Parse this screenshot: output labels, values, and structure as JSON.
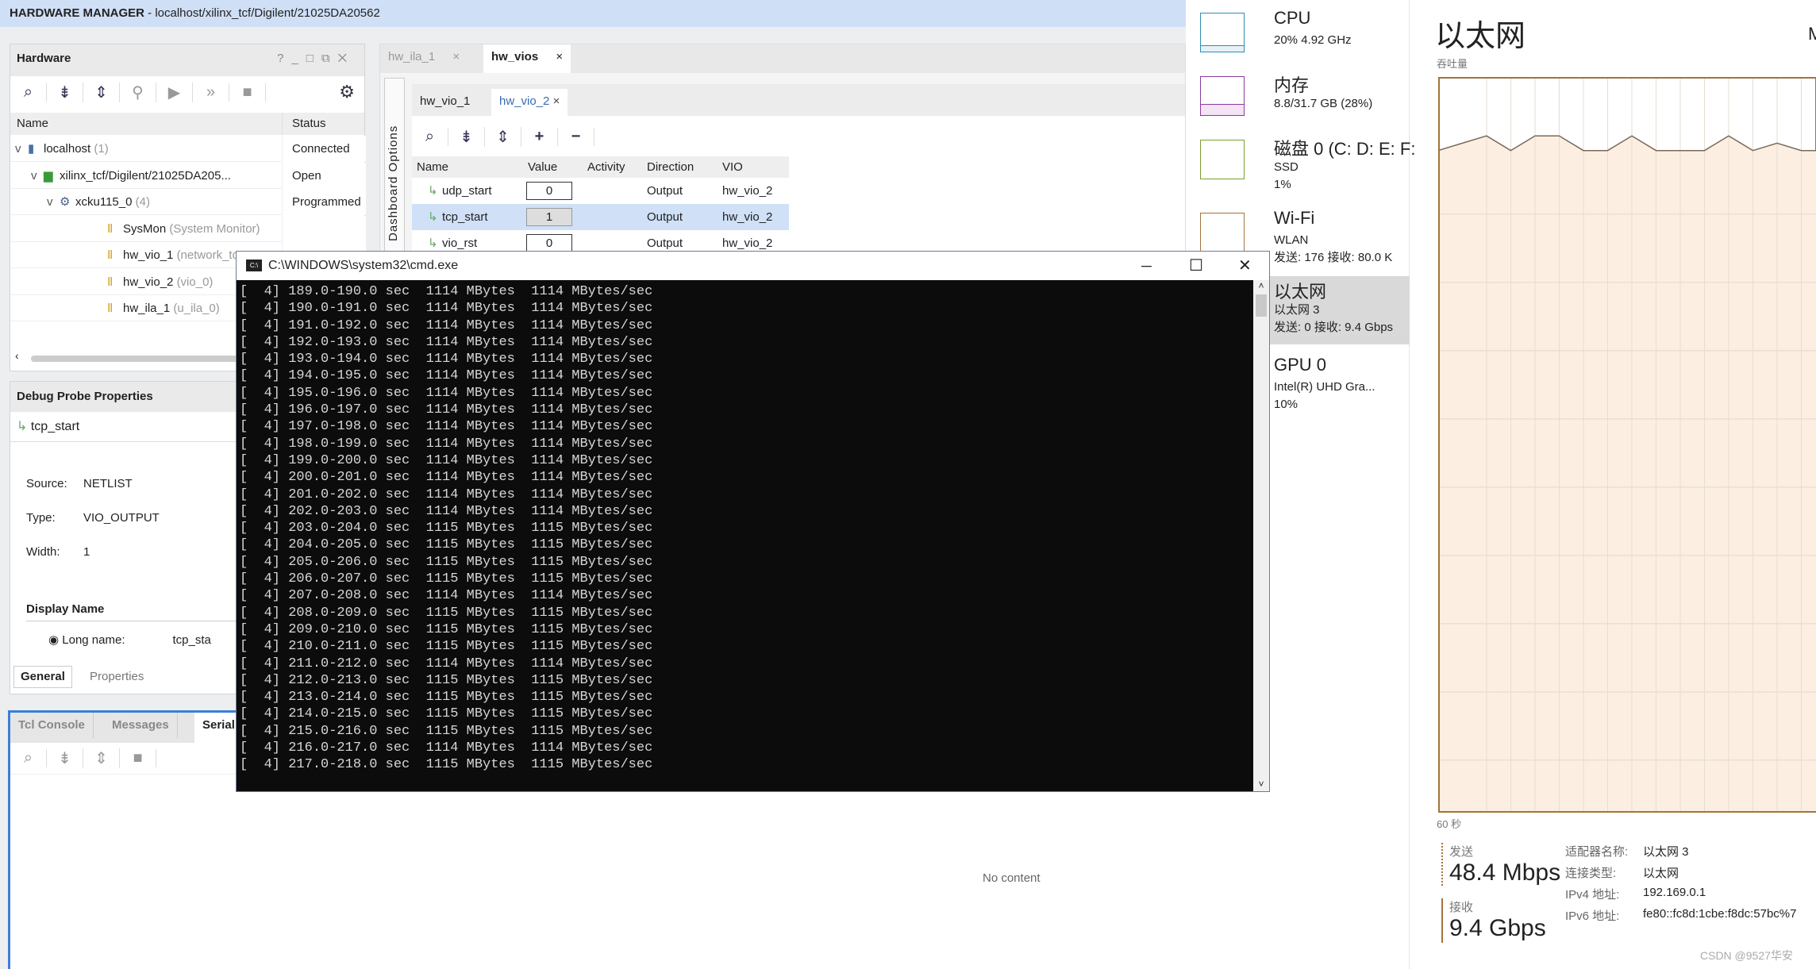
{
  "vivado": {
    "title_bold": "HARDWARE MANAGER",
    "title_rest": " - localhost/xilinx_tcf/Digilent/21025DA20562",
    "hardware": {
      "title": "Hardware",
      "ctrl_icons": [
        "?",
        "_",
        "□",
        "⧉",
        "X"
      ],
      "columns": [
        "Name",
        "Status"
      ],
      "rows": [
        {
          "name": "localhost",
          "extra": "(1)",
          "status": "Connected",
          "indent": 0,
          "icon": "server-icon",
          "chev": "v"
        },
        {
          "name": "xilinx_tcf/Digilent/21025DA205...",
          "extra": "",
          "status": "Open",
          "indent": 1,
          "icon": "board-icon",
          "chev": "v"
        },
        {
          "name": "xcku115_0",
          "extra": "(4)",
          "status": "Programmed",
          "indent": 2,
          "icon": "chip-icon",
          "chev": "v"
        },
        {
          "name": "SysMon",
          "extra": "(System Monitor)",
          "status": "",
          "indent": 3,
          "icon": "core-icon",
          "chev": ""
        },
        {
          "name": "hw_vio_1",
          "extra": "(network_top",
          "status": "",
          "indent": 3,
          "icon": "core-icon",
          "chev": ""
        },
        {
          "name": "hw_vio_2",
          "extra": "(vio_0)",
          "status": "",
          "indent": 3,
          "icon": "core-icon",
          "chev": ""
        },
        {
          "name": "hw_ila_1",
          "extra": "(u_ila_0)",
          "status": "",
          "indent": 3,
          "icon": "core-icon",
          "chev": ""
        }
      ]
    },
    "probe": {
      "title": "Debug Probe Properties",
      "name": "tcp_start",
      "props": [
        {
          "label": "Source:",
          "value": "NETLIST"
        },
        {
          "label": "Type:",
          "value": "VIO_OUTPUT"
        },
        {
          "label": "Width:",
          "value": "1"
        }
      ],
      "display_name": "Display Name",
      "long_name_label": "Long name:",
      "long_name_value": "tcp_sta",
      "tabs": [
        "General",
        "Properties"
      ]
    },
    "console": {
      "tabs": [
        "Tcl Console",
        "Messages",
        "Serial I"
      ]
    },
    "main_tabs": [
      "hw_ila_1",
      "hw_vios"
    ],
    "dashboard_label": "Dashboard Options",
    "vio_tabs": [
      "hw_vio_1",
      "hw_vio_2"
    ],
    "vio_columns": [
      "Name",
      "Value",
      "Activity",
      "Direction",
      "VIO"
    ],
    "vio_rows": [
      {
        "name": "udp_start",
        "value": "0",
        "activity": "",
        "direction": "Output",
        "vio": "hw_vio_2"
      },
      {
        "name": "tcp_start",
        "value": "1",
        "activity": "",
        "direction": "Output",
        "vio": "hw_vio_2"
      },
      {
        "name": "vio_rst",
        "value": "0",
        "activity": "",
        "direction": "Output",
        "vio": "hw_vio_2"
      }
    ],
    "no_content": "No content"
  },
  "cmd": {
    "title": "C:\\WINDOWS\\system32\\cmd.exe",
    "lines": [
      "[  4] 189.0-190.0 sec  1114 MBytes  1114 MBytes/sec",
      "[  4] 190.0-191.0 sec  1114 MBytes  1114 MBytes/sec",
      "[  4] 191.0-192.0 sec  1114 MBytes  1114 MBytes/sec",
      "[  4] 192.0-193.0 sec  1114 MBytes  1114 MBytes/sec",
      "[  4] 193.0-194.0 sec  1114 MBytes  1114 MBytes/sec",
      "[  4] 194.0-195.0 sec  1114 MBytes  1114 MBytes/sec",
      "[  4] 195.0-196.0 sec  1114 MBytes  1114 MBytes/sec",
      "[  4] 196.0-197.0 sec  1114 MBytes  1114 MBytes/sec",
      "[  4] 197.0-198.0 sec  1114 MBytes  1114 MBytes/sec",
      "[  4] 198.0-199.0 sec  1114 MBytes  1114 MBytes/sec",
      "[  4] 199.0-200.0 sec  1114 MBytes  1114 MBytes/sec",
      "[  4] 200.0-201.0 sec  1114 MBytes  1114 MBytes/sec",
      "[  4] 201.0-202.0 sec  1114 MBytes  1114 MBytes/sec",
      "[  4] 202.0-203.0 sec  1114 MBytes  1114 MBytes/sec",
      "[  4] 203.0-204.0 sec  1115 MBytes  1115 MBytes/sec",
      "[  4] 204.0-205.0 sec  1115 MBytes  1115 MBytes/sec",
      "[  4] 205.0-206.0 sec  1115 MBytes  1115 MBytes/sec",
      "[  4] 206.0-207.0 sec  1115 MBytes  1115 MBytes/sec",
      "[  4] 207.0-208.0 sec  1114 MBytes  1114 MBytes/sec",
      "[  4] 208.0-209.0 sec  1115 MBytes  1115 MBytes/sec",
      "[  4] 209.0-210.0 sec  1115 MBytes  1115 MBytes/sec",
      "[  4] 210.0-211.0 sec  1115 MBytes  1115 MBytes/sec",
      "[  4] 211.0-212.0 sec  1114 MBytes  1114 MBytes/sec",
      "[  4] 212.0-213.0 sec  1115 MBytes  1115 MBytes/sec",
      "[  4] 213.0-214.0 sec  1115 MBytes  1115 MBytes/sec",
      "[  4] 214.0-215.0 sec  1115 MBytes  1115 MBytes/sec",
      "[  4] 215.0-216.0 sec  1115 MBytes  1115 MBytes/sec",
      "[  4] 216.0-217.0 sec  1114 MBytes  1114 MBytes/sec",
      "[  4] 217.0-218.0 sec  1115 MBytes  1115 MBytes/sec"
    ]
  },
  "taskmgr": {
    "list": [
      {
        "name": "CPU",
        "sub1": "20% 4.92 GHz",
        "sub2": "",
        "color": "#2d8fb5"
      },
      {
        "name": "内存",
        "sub1": "8.8/31.7 GB (28%)",
        "sub2": "",
        "color": "#8b3aa0"
      },
      {
        "name": "磁盘 0 (C: D: E: F:",
        "sub1": "SSD",
        "sub2": "1%",
        "color": "#7aa02c"
      },
      {
        "name": "Wi-Fi",
        "sub1": "WLAN",
        "sub2": "发送: 176 接收: 80.0 K",
        "color": "#a4733d"
      },
      {
        "name": "以太网",
        "sub1": "以太网 3",
        "sub2": "发送: 0 接收: 9.4 Gbps",
        "color": "#a4733d",
        "selected": true
      },
      {
        "name": "GPU 0",
        "sub1": "Intel(R) UHD Gra...",
        "sub2": "10%",
        "color": "#2d8fb5"
      }
    ],
    "title": "以太网",
    "title_right": "M",
    "chart_label": "吞吐量",
    "time_label": "60 秒",
    "throughput_level": [
      0.9,
      0.91,
      0.92,
      0.9,
      0.92,
      0.92,
      0.9,
      0.9,
      0.92,
      0.9,
      0.9,
      0.9,
      0.92,
      0.9,
      0.91,
      0.9,
      0.9,
      0.92,
      0.9,
      0.9,
      0.92,
      0.9,
      0.9,
      0.92,
      0.91,
      0.92,
      0.9,
      0.91,
      0.89,
      0.91
    ],
    "send_label": "发送",
    "send_value": "48.4 Mbps",
    "recv_label": "接收",
    "recv_value": "9.4 Gbps",
    "details": [
      {
        "label": "适配器名称:",
        "value": "以太网 3"
      },
      {
        "label": "连接类型:",
        "value": "以太网"
      },
      {
        "label": "IPv4 地址:",
        "value": "192.169.0.1"
      },
      {
        "label": "IPv6 地址:",
        "value": "fe80::fc8d:1cbe:f8dc:57bc%7"
      }
    ],
    "chart_color": "#a4733d"
  },
  "watermark": "CSDN @9527华安"
}
